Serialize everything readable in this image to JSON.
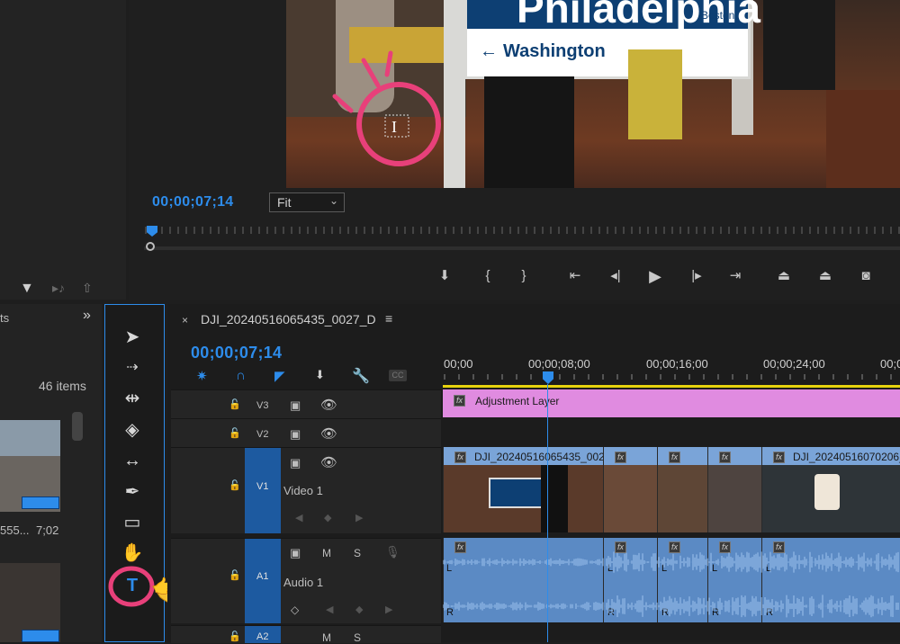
{
  "monitor": {
    "timecode": "00;00;07;14",
    "zoom": "Fit",
    "sign": {
      "city": "Philadelphia",
      "destination_left": "Washington",
      "destination_right": "Boston"
    }
  },
  "project": {
    "items_count": "46 items",
    "panel_tab_fragment": "ts",
    "clip_name_fragment": "555...",
    "clip_duration": "7;02"
  },
  "timeline": {
    "sequence_name": "DJI_20240516065435_0027_D",
    "timecode": "00;00;07;14",
    "ruler": [
      "00;00",
      "00;00;08;00",
      "00;00;16;00",
      "00;00;24;00",
      "00;00"
    ],
    "tracks": {
      "v3": "V3",
      "v2": "V2",
      "v1": "V1",
      "video1": "Video 1",
      "a1": "A1",
      "audio1": "Audio 1",
      "a2": "A2"
    },
    "mute_label": "M",
    "solo_label": "S",
    "adjustment_layer": "Adjustment Layer",
    "clips": [
      {
        "name": "DJI_20240516065435_002",
        "fx": "fx"
      },
      {
        "name": "",
        "fx": "fx"
      },
      {
        "name": "",
        "fx": "fx"
      },
      {
        "name": "",
        "fx": "fx"
      },
      {
        "name": "DJI_20240516070206_",
        "fx": "fx"
      }
    ],
    "cc_label": "CC",
    "audio_channel_L": "L",
    "audio_channel_R": "R"
  },
  "colors": {
    "accent": "#2d8ceb",
    "adjustment_layer": "#e08be0",
    "video_clip": "#7aa4d8",
    "audio_clip": "#5b8ac4",
    "annotation": "#e8407a"
  },
  "icons": {
    "selection": "selection-tool-icon",
    "track_select": "track-select-forward-icon",
    "ripple": "ripple-edit-icon",
    "razor": "razor-icon",
    "slip": "slip-icon",
    "pen": "pen-icon",
    "rectangle": "rectangle-icon",
    "hand": "hand-icon",
    "type": "type-tool-icon"
  }
}
